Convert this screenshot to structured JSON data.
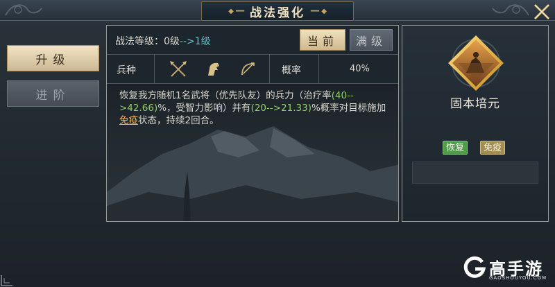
{
  "window": {
    "title": "战法强化",
    "close_icon": "close-x-icon"
  },
  "sidebar": {
    "upgrade_label": "升级",
    "advance_label": "进阶"
  },
  "level_row": {
    "label_prefix": "战法等级：",
    "level_from": "0级",
    "arrow": "-->",
    "level_to": "1级",
    "current_label": "当前",
    "max_label": "满级"
  },
  "troops_row": {
    "label": "兵种",
    "icons": [
      "spear-icon",
      "horse-icon",
      "bow-icon"
    ],
    "rate_label": "概率",
    "rate_value": "40%"
  },
  "description": {
    "part1": "恢复我方随机1名武将（优先队友）的兵力（治疗率",
    "heal_range": "(40-->42.66)",
    "part2": "%，受智力影响）并有",
    "prob_range": "(20-->21.33)",
    "part3": "%概率对目标施加",
    "keyword": "免疫",
    "part4": "状态，持续2回合。"
  },
  "skill": {
    "name": "固本培元",
    "tags": [
      "恢复",
      "免疫"
    ],
    "colors": {
      "recover": "#4f9d4a",
      "immune": "#a48d52",
      "frame": "#e8b12a"
    }
  },
  "watermark": {
    "brand": "高手游",
    "domain": "GAOSHOUYOU.COM"
  }
}
